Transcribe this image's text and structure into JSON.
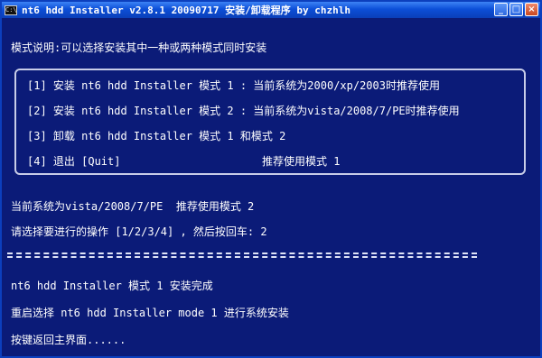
{
  "window": {
    "title": "nt6 hdd Installer v2.8.1 20090717 安装/卸载程序 by chzhlh",
    "icon_label": "C:\\",
    "buttons": {
      "minimize": "_",
      "maximize": "□",
      "close": "×"
    }
  },
  "console": {
    "mode_desc": "模式说明:可以选择安装其中一种或两种模式同时安装",
    "menu": [
      {
        "label": "[1] 安装 nt6 hdd Installer 模式 1 : 当前系统为2000/xp/2003时推荐使用"
      },
      {
        "label": "[2] 安装 nt6 hdd Installer 模式 2 : 当前系统为vista/2008/7/PE时推荐使用"
      },
      {
        "label": "[3] 卸载 nt6 hdd Installer 模式 1 和模式 2"
      },
      {
        "label": "[4] 退出 [Quit]",
        "note": "推荐使用模式 1"
      }
    ],
    "current_system": "当前系统为vista/2008/7/PE  推荐使用模式 2",
    "prompt": "请选择要进行的操作 [1/2/3/4] , 然后按回车: 2",
    "result_1": "nt6 hdd Installer 模式 1 安装完成",
    "result_2": "重启选择 nt6 hdd Installer mode 1 进行系统安装",
    "result_3": "按键返回主界面......"
  }
}
